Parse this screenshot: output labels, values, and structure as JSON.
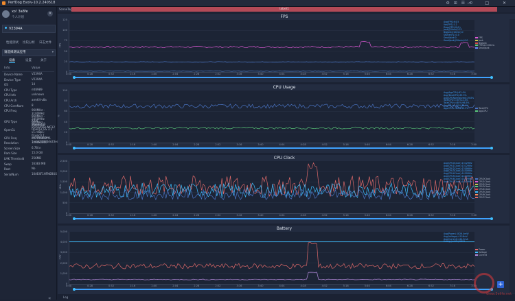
{
  "window": {
    "title": "PerfDog Evolv-10.2.240518",
    "controls": [
      "—",
      "□",
      "✕"
    ],
    "toolbar_icons": [
      "⚙",
      "⊞",
      "☰",
      "⟲"
    ]
  },
  "sidebar": {
    "user": {
      "name": "xo! 3a8fe",
      "level": "个人计划"
    },
    "device": "V2394A",
    "tabs": [
      "性能测试",
      "比较分析",
      "日志文件"
    ],
    "app_select": "请选择测试应用",
    "subtabs": [
      "设备",
      "设置",
      "关于"
    ],
    "info_header": {
      "key": "Info",
      "value": "Value"
    },
    "info": [
      {
        "k": "Device Name",
        "v": "V2394A"
      },
      {
        "k": "Device Type",
        "v": "V2394A"
      },
      {
        "k": "OS",
        "v": "14"
      },
      {
        "k": "CPU Type",
        "v": "mt6989"
      },
      {
        "k": "CPU Info",
        "v": "unknown"
      },
      {
        "k": "CPU Arch",
        "v": "arm64-v8a"
      },
      {
        "k": "CPU CoreNum",
        "v": "8"
      },
      {
        "k": "CPU Freq",
        "v": "960MHz - 3100MHz\n960MHz - 2850MHz\n960MHz - 2400MHz"
      },
      {
        "k": "GPU Type",
        "v": "ARM\nMali-G720 Immortalis MC12"
      },
      {
        "k": "OpenGL",
        "v": "OpenGL ES 3.2 v1.r48p1-01eac0.7 c9770b6c2ff6\n1e4ebf33d4de23ed4"
      },
      {
        "k": "GPU Freq",
        "v": "unavailable"
      },
      {
        "k": "Resolution",
        "v": "1260x2800"
      },
      {
        "k": "Screen Size",
        "v": "6.78 in"
      },
      {
        "k": "Ram Size",
        "v": "15.0 GB"
      },
      {
        "k": "LMK Threshold",
        "v": "256MB"
      },
      {
        "k": "Swap",
        "v": "16383 MB"
      },
      {
        "k": "Root",
        "v": "No"
      },
      {
        "k": "SerialNum",
        "v": "10AE4F1HFN0BUX"
      }
    ],
    "collapse": "«"
  },
  "main": {
    "scene_tag": "SceneTag",
    "label": "label1",
    "log": "Log",
    "add": "+",
    "watermark": "www.3elife.net"
  },
  "x_ticks": [
    "0:00",
    "0:28",
    "0:52",
    "1:16",
    "1:40",
    "2:04",
    "2:28",
    "2:52",
    "3:16",
    "3:40",
    "4:04",
    "4:28",
    "4:52",
    "5:16",
    "5:40",
    "6:04",
    "6:28",
    "6:52",
    "7:16",
    "7:40"
  ],
  "panels": [
    {
      "title": "FPS",
      "ylabel": "FPS",
      "yticks": [
        "125",
        "100",
        "75",
        "50",
        "25",
        "0"
      ],
      "ymax": 125,
      "stats": "Avg(FPS):64.5\nVar(FPS):1.2\nDrop(FPS):0(/h)\nJank(/10min):0.5\nBigJank(/10min):0\nStutter(%):0.0\nSmallJank:0\nSmallJank(/10min):0.0",
      "legend": [
        {
          "name": "FPS",
          "color": "#e05ad8"
        },
        {
          "name": "Jank",
          "color": "#c8c24a"
        },
        {
          "name": "BigJank",
          "color": "#d94b4b"
        },
        {
          "name": "FTime>100ms",
          "color": "#5ac87a"
        },
        {
          "name": "SmallJank",
          "color": "#6a8cff"
        }
      ],
      "series": [
        {
          "color": "#e05ad8",
          "base": 60,
          "noise": 2,
          "spikes": [
            [
              430,
              72
            ],
            [
              575,
              70
            ]
          ]
        },
        {
          "color": "#4a74c4",
          "base": 24,
          "noise": 1,
          "spikes": []
        },
        {
          "color": "#5a8ad8",
          "base": 2,
          "noise": 0.5,
          "spikes": []
        }
      ]
    },
    {
      "title": "CPU Usage",
      "ylabel": "%",
      "yticks": [
        "100",
        "80",
        "60",
        "40",
        "20",
        "0"
      ],
      "ymax": 100,
      "stats": "Avg(AppCPU):62.4%\nAvg(TotalCPU):69.3%\nAvg(CPUNormalized):19.8%\nTotalCPU<=50%:2.2%\nTotalCPU<=80%:96.5%\nAppCPU<=60%:38.1%\nAppCPU<=80%:99.3%",
      "legend": [
        {
          "name": "TotalCPU",
          "color": "#4a74c4"
        },
        {
          "name": "AppCPU",
          "color": "#5ac87a"
        }
      ],
      "series": [
        {
          "color": "#4a74c4",
          "base": 70,
          "noise": 4,
          "spikes": []
        },
        {
          "color": "#5ac87a",
          "base": 28,
          "noise": 2,
          "spikes": []
        }
      ]
    },
    {
      "title": "CPU Clock",
      "ylabel": "MHz",
      "yticks": [
        "2,500",
        "2,000",
        "1,500",
        "1,000",
        "500",
        "0"
      ],
      "ymax": 2500,
      "stats": "Avg(CPU0Clock):1312MHz\nAvg(CPU1Clock):1312MHz\nAvg(CPU2Clock):1309MHz\nAvg(CPU3Clock):1450MHz\nAvg(CPU4Clock):1450MHz\nAvg(CPU5Clock):1450MHz\nAvg(CPU6Clock):1402MHz\nAvg(CPU7Clock):1402MHz",
      "legend": [
        {
          "name": "CPU0Clock",
          "color": "#4a74c4"
        },
        {
          "name": "CPU1Clock",
          "color": "#e05ad8"
        },
        {
          "name": "CPU2Clock",
          "color": "#c8c24a"
        },
        {
          "name": "CPU3Clock",
          "color": "#5ac87a"
        },
        {
          "name": "CPU4Clock",
          "color": "#d94b4b"
        },
        {
          "name": "CPU5Clock",
          "color": "#3fbfff"
        },
        {
          "name": "CPU6Clock",
          "color": "#ff8a5a"
        },
        {
          "name": "CPU7Clock",
          "color": "#e06a6a"
        }
      ],
      "series": [
        {
          "color": "#e06a6a",
          "base": 1300,
          "noise": 500,
          "spikes": [
            [
              355,
              2400
            ]
          ]
        },
        {
          "color": "#3fbfff",
          "base": 1100,
          "noise": 350,
          "spikes": []
        },
        {
          "color": "#4a74c4",
          "base": 900,
          "noise": 250,
          "spikes": []
        }
      ]
    },
    {
      "title": "Battery",
      "ylabel": "mW",
      "yticks": [
        "5,000",
        "4,000",
        "3,000",
        "2,000",
        "1,000",
        "0"
      ],
      "ymax": 5000,
      "stats": "Avg(Power):1826.4mW\nAvg(Voltage):4118mV\nAvg(Current):444.5mA\nEnergy(mWh):5831",
      "legend": [
        {
          "name": "Power",
          "color": "#e06a6a"
        },
        {
          "name": "Voltage",
          "color": "#3fbfff"
        },
        {
          "name": "Current",
          "color": "#b48adc"
        }
      ],
      "series": [
        {
          "color": "#e06a6a",
          "base": 1700,
          "noise": 250,
          "spikes": [
            [
              355,
              3900
            ]
          ]
        },
        {
          "color": "#3fbfff",
          "base": 4050,
          "noise": 0,
          "spikes": []
        },
        {
          "color": "#b48adc",
          "base": 420,
          "noise": 40,
          "spikes": [
            [
              355,
              1100
            ]
          ]
        }
      ]
    }
  ]
}
